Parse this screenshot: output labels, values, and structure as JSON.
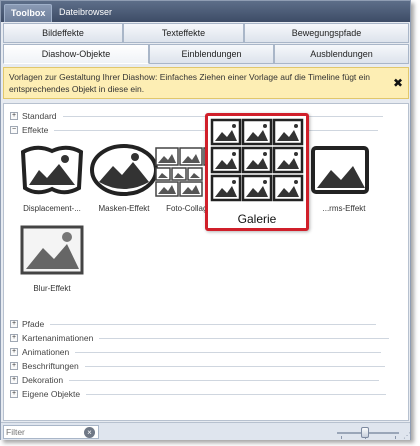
{
  "top_tabs": [
    {
      "label": "Toolbox",
      "active": true
    },
    {
      "label": "Dateibrowser",
      "active": false
    }
  ],
  "category_tabs": {
    "row1": [
      "Bildeffekte",
      "Texteffekte",
      "Bewegungspfade"
    ],
    "row2": [
      "Diashow-Objekte",
      "Einblendungen",
      "Ausblendungen"
    ],
    "active": "Diashow-Objekte"
  },
  "info": {
    "text": "Vorlagen zur Gestaltung Ihrer Diashow: Einfaches Ziehen einer Vorlage auf die Timeline fügt ein entsprechendes Objekt in diese ein.",
    "close_symbol": "✖"
  },
  "sections_top": [
    {
      "label": "Standard",
      "toggle": "+"
    },
    {
      "label": "Effekte",
      "toggle": "−"
    }
  ],
  "effects": [
    {
      "label": "Displacement-..."
    },
    {
      "label": "Masken-Effekt"
    },
    {
      "label": "Foto-Collage"
    },
    {
      "label": "...rms-Effekt"
    },
    {
      "label": "Blur-Effekt"
    }
  ],
  "gallery": {
    "label": "Galerie"
  },
  "sections_bottom": [
    {
      "label": "Pfade",
      "toggle": "+"
    },
    {
      "label": "Kartenanimationen",
      "toggle": "+"
    },
    {
      "label": "Animationen",
      "toggle": "+"
    },
    {
      "label": "Beschriftungen",
      "toggle": "+"
    },
    {
      "label": "Dekoration",
      "toggle": "+"
    },
    {
      "label": "Eigene Objekte",
      "toggle": "+"
    }
  ],
  "filter": {
    "placeholder": "Filter",
    "clear_symbol": "×"
  },
  "colors": {
    "highlight": "#d01f2a",
    "info_bg": "#fdeeb4",
    "tab_strip": "#3d4c66"
  }
}
